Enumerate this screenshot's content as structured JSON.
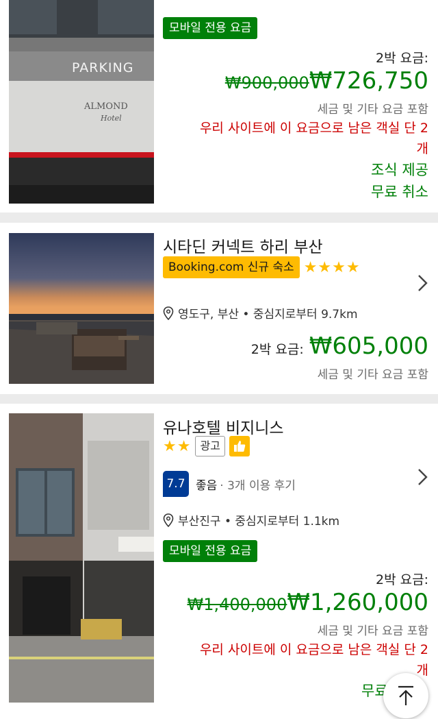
{
  "cards": [
    {
      "badge": "모바일 전용 요금",
      "price_label": "2박 요금:",
      "old_price": "₩900,000",
      "new_price": "₩726,750",
      "tax": "세금 및 기타 요금 포함",
      "warning_line1": "우리 사이트에 이 요금으로 남은 객실 단 2",
      "warning_line2": "개",
      "perk1": "조식 제공",
      "perk2": "무료 취소",
      "photo_text_parking": "PARKING",
      "photo_text_logo": "ALMOND",
      "photo_text_hotel": "Hotel"
    },
    {
      "title": "시타딘 커넥트 하리 부산",
      "new_badge": "Booking.com 신규 숙소",
      "stars": "★★★★",
      "location": "영도구, 부산 • 중심지로부터 9.7km",
      "price_label": "2박 요금:",
      "new_price": "₩605,000",
      "tax": "세금 및 기타 요금 포함"
    },
    {
      "title": "유나호텔 비지니스",
      "stars": "★★",
      "ad_label": "광고",
      "score": "7.7",
      "review_word": "좋음",
      "review_count": "· 3개 이용 후기",
      "location": "부산진구 • 중심지로부터 1.1km",
      "badge": "모바일 전용 요금",
      "price_label": "2박 요금:",
      "old_price": "₩1,400,000",
      "new_price": "₩1,260,000",
      "tax": "세금 및 기타 요금 포함",
      "warning_line1": "우리 사이트에 이 요금으로 남은 객실 단 2",
      "warning_line2": "개",
      "perk1": "무료"
    }
  ],
  "colors": {
    "green": "#008009",
    "red": "#cc0000",
    "booking_yellow": "#febb02",
    "score_blue": "#003b95"
  },
  "icons": {
    "location": "map-pin-icon",
    "chevron": "chevron-right-icon",
    "thumbs": "thumbs-up-icon",
    "scroll_top": "arrow-up-icon"
  }
}
